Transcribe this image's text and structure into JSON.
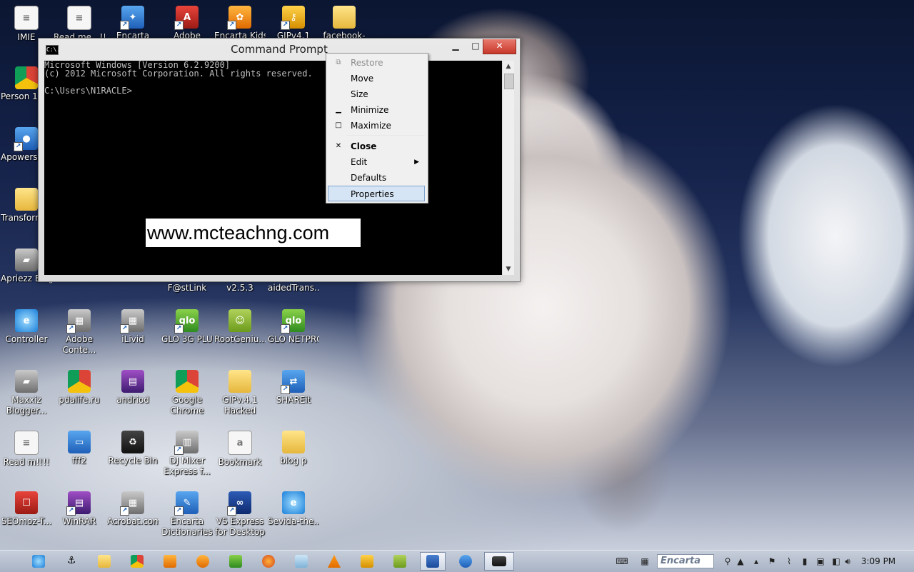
{
  "desktop": {
    "icons": [
      {
        "label": "IMIE",
        "kind": "doc"
      },
      {
        "label": "Read me...!!!",
        "kind": "doc"
      },
      {
        "label": "Encarta",
        "kind": "blue"
      },
      {
        "label": "Adobe",
        "kind": "red"
      },
      {
        "label": "Encarta Kids",
        "kind": "orange"
      },
      {
        "label": "GIPv4.1",
        "kind": "gold"
      },
      {
        "label": "facebook-",
        "kind": "folder"
      },
      {
        "label": "Person 1 - Chrome",
        "kind": "chrome"
      },
      {
        "label": "Apowersoft Screen Re...",
        "kind": "blue"
      },
      {
        "label": "Transform Design a...",
        "kind": "folder"
      },
      {
        "label": "Apriezz Blogger ...",
        "kind": "gray"
      },
      {
        "label": "F@stLink",
        "kind": "blue"
      },
      {
        "label": "v2.5.3",
        "kind": "blue"
      },
      {
        "label": "aidedTrans...",
        "kind": "blue"
      },
      {
        "label": "Controller",
        "kind": "ie"
      },
      {
        "label": "Adobe Conte...",
        "kind": "gray"
      },
      {
        "label": "iLivid",
        "kind": "gray"
      },
      {
        "label": "GLO 3G PLUS",
        "kind": "green"
      },
      {
        "label": "RootGeniu...",
        "kind": "green"
      },
      {
        "label": "GLO NETPRO",
        "kind": "green"
      },
      {
        "label": "Maxxiz Blogger...",
        "kind": "gray"
      },
      {
        "label": "pdalife.ru",
        "kind": "chrome"
      },
      {
        "label": "andriod",
        "kind": "rar"
      },
      {
        "label": "Google Chrome",
        "kind": "chrome"
      },
      {
        "label": "GIPv.4.1 Hacked",
        "kind": "folder"
      },
      {
        "label": "SHAREit",
        "kind": "blue"
      },
      {
        "label": "Read m!!!!",
        "kind": "doc"
      },
      {
        "label": "fff2",
        "kind": "blue"
      },
      {
        "label": "Recycle Bin",
        "kind": "dark"
      },
      {
        "label": "DJ Mixer Express f...",
        "kind": "gray"
      },
      {
        "label": "Bookmark",
        "kind": "doc"
      },
      {
        "label": "blog p",
        "kind": "folder"
      },
      {
        "label": "SEOmoz-T...",
        "kind": "red"
      },
      {
        "label": "WinRAR",
        "kind": "rar"
      },
      {
        "label": "Acrobat.com",
        "kind": "gray"
      },
      {
        "label": "Encarta Dictionaries",
        "kind": "blue"
      },
      {
        "label": "VS Express for Desktop",
        "kind": "vs"
      },
      {
        "label": "Sevida-the...",
        "kind": "ie"
      }
    ]
  },
  "cmd_window": {
    "title": "Command Prompt",
    "sys_icon": "C:\\.",
    "min_label": "▁",
    "max_label": "□",
    "close_label": "✕",
    "console_lines": [
      "Microsoft Windows [Version 6.2.9200]",
      "(c) 2012 Microsoft Corporation. All rights reserved.",
      "",
      "C:\\Users\\N1RACLE>"
    ],
    "watermark": "www.mcteachng.com"
  },
  "system_menu": {
    "items": [
      {
        "label": "Restore",
        "state": "disabled",
        "icon": "⧉"
      },
      {
        "label": "Move",
        "state": "normal",
        "icon": ""
      },
      {
        "label": "Size",
        "state": "normal",
        "icon": ""
      },
      {
        "label": "Minimize",
        "state": "normal",
        "icon": "▁"
      },
      {
        "label": "Maximize",
        "state": "normal",
        "icon": "□"
      },
      {
        "label": "Close",
        "state": "bold",
        "icon": "✕"
      },
      {
        "label": "Edit",
        "state": "normal",
        "icon": "",
        "submenu": true
      },
      {
        "label": "Defaults",
        "state": "normal",
        "icon": ""
      },
      {
        "label": "Properties",
        "state": "hover",
        "icon": ""
      }
    ],
    "submenu_arrow": "▶"
  },
  "taskbar": {
    "pinned": [
      "ie-icon",
      "tools-icon",
      "explorer-icon",
      "chrome-icon",
      "media-player-icon",
      "firefox-orange-icon",
      "sync-icon",
      "firefox-icon",
      "notepad-icon",
      "vlc-icon",
      "key-icon",
      "android-icon",
      "word-icon",
      "teamviewer-icon",
      "cmd-icon"
    ],
    "active_app": "cmd-icon",
    "search_text": "Encarta",
    "clock": "3:09 PM"
  },
  "colors": {
    "console_bg": "#000000",
    "console_text": "#c0c0c0",
    "close_button": "#c7382a",
    "menu_hover": "#d6e5f5"
  }
}
